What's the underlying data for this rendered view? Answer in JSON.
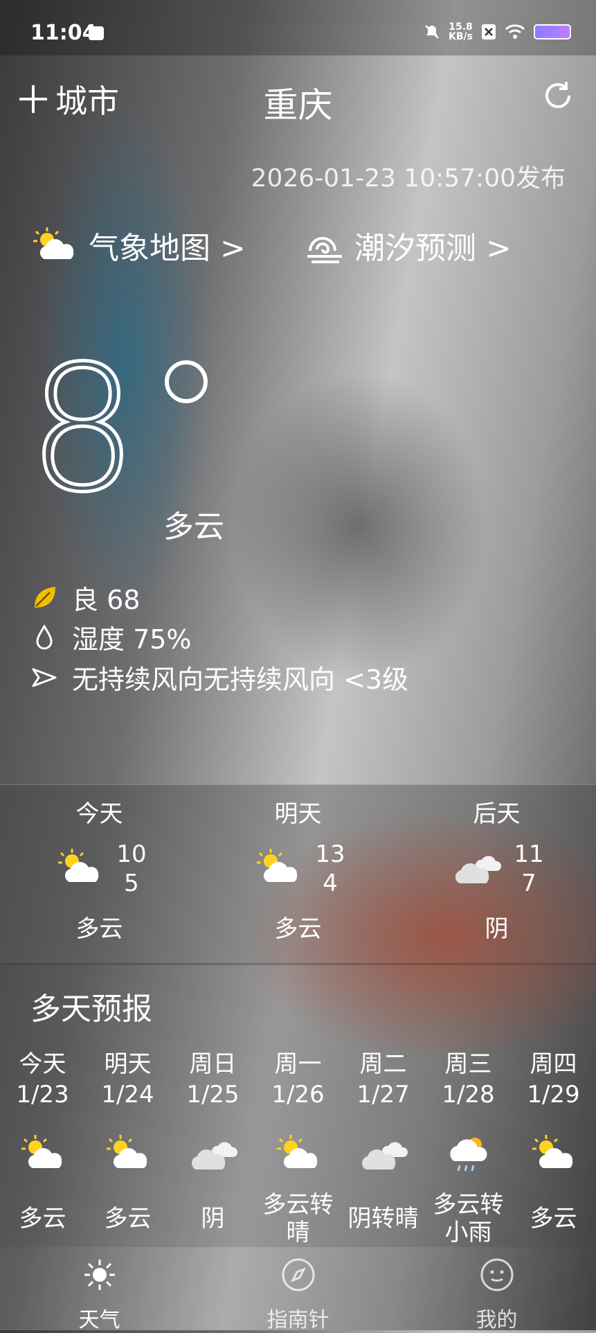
{
  "status_bar": {
    "time": "11:04",
    "net_speed_top": "15.8",
    "net_speed_bottom": "KB/s"
  },
  "header": {
    "city_button": "城市",
    "title": "重庆",
    "published": "2026-01-23 10:57:00发布"
  },
  "links": {
    "weather_map": "气象地图 >",
    "tide_forecast": "潮汐预测 >"
  },
  "current": {
    "temperature": "8",
    "condition": "多云",
    "air_quality": "良 68",
    "humidity": "湿度 75%",
    "wind": "无持续风向无持续风向 <3级"
  },
  "three_day": [
    {
      "day": "今天",
      "high": "10",
      "low": "5",
      "cond": "多云",
      "icon": "partly-cloudy"
    },
    {
      "day": "明天",
      "high": "13",
      "low": "4",
      "cond": "多云",
      "icon": "partly-cloudy"
    },
    {
      "day": "后天",
      "high": "11",
      "low": "7",
      "cond": "阴",
      "icon": "overcast"
    }
  ],
  "multi_day": {
    "title": "多天预报",
    "days": [
      {
        "day": "今天",
        "date": "1/23",
        "cond": "多云",
        "icon": "partly-cloudy"
      },
      {
        "day": "明天",
        "date": "1/24",
        "cond": "多云",
        "icon": "partly-cloudy"
      },
      {
        "day": "周日",
        "date": "1/25",
        "cond": "阴",
        "icon": "overcast"
      },
      {
        "day": "周一",
        "date": "1/26",
        "cond": "多云转晴",
        "icon": "partly-cloudy"
      },
      {
        "day": "周二",
        "date": "1/27",
        "cond": "阴转晴",
        "icon": "overcast"
      },
      {
        "day": "周三",
        "date": "1/28",
        "cond": "多云转小雨",
        "icon": "rain"
      },
      {
        "day": "周四",
        "date": "1/29",
        "cond": "多云",
        "icon": "partly-cloudy"
      }
    ]
  },
  "nav": {
    "weather": "天气",
    "compass": "指南针",
    "mine": "我的"
  }
}
